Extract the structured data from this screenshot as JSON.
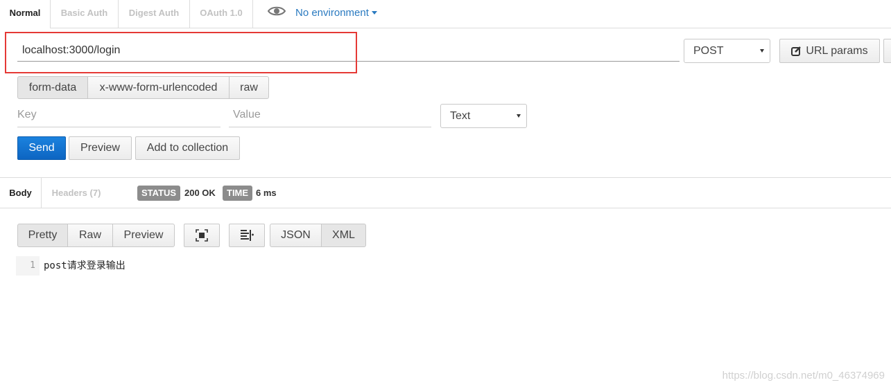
{
  "auth_tabs": [
    {
      "label": "Normal",
      "active": true
    },
    {
      "label": "Basic Auth",
      "active": false
    },
    {
      "label": "Digest Auth",
      "active": false
    },
    {
      "label": "OAuth 1.0",
      "active": false
    }
  ],
  "environment": {
    "label": "No environment",
    "icon": "eye-icon"
  },
  "request": {
    "url": "localhost:3000/login",
    "method": "POST",
    "url_params_label": "URL params"
  },
  "body_types": [
    "form-data",
    "x-www-form-urlencoded",
    "raw"
  ],
  "form_row": {
    "key_placeholder": "Key",
    "value_placeholder": "Value",
    "type": "Text"
  },
  "actions": {
    "send": "Send",
    "preview": "Preview",
    "add_to_collection": "Add to collection"
  },
  "response": {
    "tabs": [
      "Body",
      "Headers (7)"
    ],
    "status_label": "STATUS",
    "status_value": "200 OK",
    "time_label": "TIME",
    "time_value": "6 ms",
    "view_modes": [
      "Pretty",
      "Raw",
      "Preview"
    ],
    "formats": [
      "JSON",
      "XML"
    ],
    "lines": [
      {
        "number": "1",
        "text": "post请求登录输出"
      }
    ]
  },
  "watermark": "https://blog.csdn.net/m0_46374969"
}
